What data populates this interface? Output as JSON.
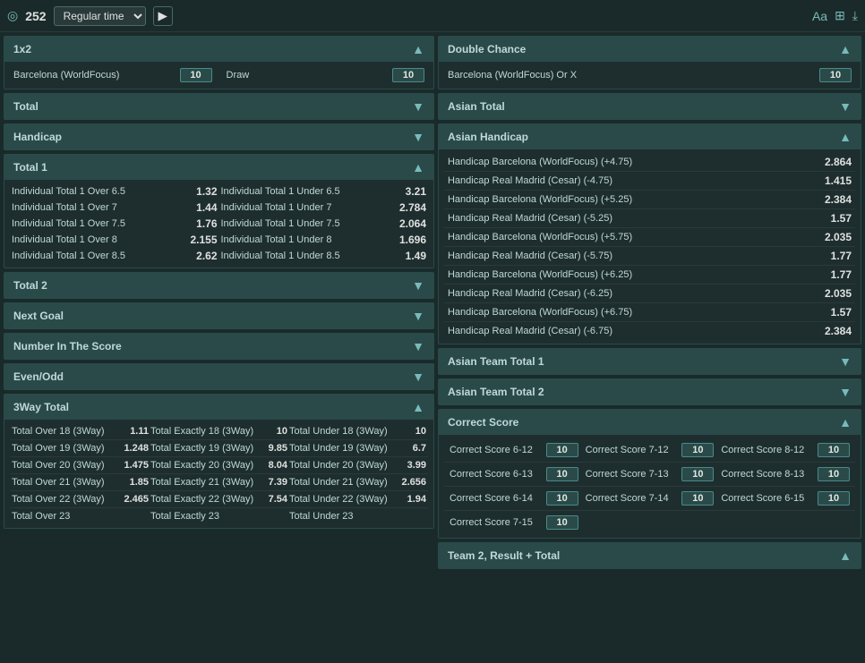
{
  "topbar": {
    "match_num": "252",
    "time_filter": "Regular time",
    "icons": {
      "eye": "◎",
      "text_size": "Aa",
      "grid": "⊞",
      "download": "⤓",
      "play": "▶"
    }
  },
  "left_col": {
    "sections": [
      {
        "id": "1x2",
        "title": "1x2",
        "collapsed": false,
        "arrow": "▲",
        "bets": [
          {
            "name": "Barcelona (WorldFocus)",
            "odds": "10"
          },
          {
            "name": "Draw",
            "odds": "10"
          }
        ]
      },
      {
        "id": "total",
        "title": "Total",
        "collapsed": true,
        "arrow": "▼"
      },
      {
        "id": "handicap",
        "title": "Handicap",
        "collapsed": true,
        "arrow": "▼"
      },
      {
        "id": "total1",
        "title": "Total 1",
        "collapsed": false,
        "arrow": "▲",
        "bet_pairs": [
          {
            "left": "Individual Total 1 Over 6.5",
            "left_odds": "1.32",
            "right": "Individual Total 1 Under 6.5",
            "right_odds": "3.21"
          },
          {
            "left": "Individual Total 1 Over 7",
            "left_odds": "1.44",
            "right": "Individual Total 1 Under 7",
            "right_odds": "2.784"
          },
          {
            "left": "Individual Total 1 Over 7.5",
            "left_odds": "1.76",
            "right": "Individual Total 1 Under 7.5",
            "right_odds": "2.064"
          },
          {
            "left": "Individual Total 1 Over 8",
            "left_odds": "2.155",
            "right": "Individual Total 1 Under 8",
            "right_odds": "1.696"
          },
          {
            "left": "Individual Total 1 Over 8.5",
            "left_odds": "2.62",
            "right": "Individual Total 1 Under 8.5",
            "right_odds": "1.49"
          }
        ]
      },
      {
        "id": "total2",
        "title": "Total 2",
        "collapsed": true,
        "arrow": "▼"
      },
      {
        "id": "next_goal",
        "title": "Next Goal",
        "collapsed": true,
        "arrow": "▼"
      },
      {
        "id": "number_in_score",
        "title": "Number In The Score",
        "collapsed": true,
        "arrow": "▼"
      },
      {
        "id": "even_odd",
        "title": "Even/Odd",
        "collapsed": true,
        "arrow": "▼"
      },
      {
        "id": "3way_total",
        "title": "3Way Total",
        "collapsed": false,
        "arrow": "▲",
        "bet_3way": [
          {
            "col1_name": "Total Over 18 (3Way)",
            "col1_odds": "1.11",
            "col2_name": "Total Exactly 18 (3Way)",
            "col2_odds": "10",
            "col3_name": "Total Under 18 (3Way)",
            "col3_odds": "10"
          },
          {
            "col1_name": "Total Over 19 (3Way)",
            "col1_odds": "1.248",
            "col2_name": "Total Exactly 19 (3Way)",
            "col2_odds": "9.85",
            "col3_name": "Total Under 19 (3Way)",
            "col3_odds": "6.7"
          },
          {
            "col1_name": "Total Over 20 (3Way)",
            "col1_odds": "1.475",
            "col2_name": "Total Exactly 20 (3Way)",
            "col2_odds": "8.04",
            "col3_name": "Total Under 20 (3Way)",
            "col3_odds": "3.99"
          },
          {
            "col1_name": "Total Over 21 (3Way)",
            "col1_odds": "1.85",
            "col2_name": "Total Exactly 21 (3Way)",
            "col2_odds": "7.39",
            "col3_name": "Total Under 21 (3Way)",
            "col3_odds": "2.656"
          },
          {
            "col1_name": "Total Over 22 (3Way)",
            "col1_odds": "2.465",
            "col2_name": "Total Exactly 22 (3Way)",
            "col2_odds": "7.54",
            "col3_name": "Total Under 22 (3Way)",
            "col3_odds": "1.94"
          },
          {
            "col1_name": "Total Over 23",
            "col1_odds": "",
            "col2_name": "Total Exactly 23",
            "col2_odds": "",
            "col3_name": "Total Under 23",
            "col3_odds": ""
          }
        ]
      }
    ]
  },
  "right_col": {
    "sections": [
      {
        "id": "double_chance",
        "title": "Double Chance",
        "collapsed": false,
        "arrow": "▲",
        "bets": [
          {
            "name": "Barcelona (WorldFocus) Or X",
            "odds": "10"
          }
        ]
      },
      {
        "id": "asian_total",
        "title": "Asian Total",
        "collapsed": true,
        "arrow": "▼"
      },
      {
        "id": "asian_handicap",
        "title": "Asian Handicap",
        "collapsed": false,
        "arrow": "▲",
        "bets_single": [
          {
            "name": "Handicap Barcelona (WorldFocus) (+4.75)",
            "odds": "2.864"
          },
          {
            "name": "Handicap Real Madrid (Cesar) (-4.75)",
            "odds": "1.415"
          },
          {
            "name": "Handicap Barcelona (WorldFocus) (+5.25)",
            "odds": "2.384"
          },
          {
            "name": "Handicap Real Madrid (Cesar) (-5.25)",
            "odds": "1.57"
          },
          {
            "name": "Handicap Barcelona (WorldFocus) (+5.75)",
            "odds": "2.035"
          },
          {
            "name": "Handicap Real Madrid (Cesar) (-5.75)",
            "odds": "1.77"
          },
          {
            "name": "Handicap Barcelona (WorldFocus) (+6.25)",
            "odds": "1.77"
          },
          {
            "name": "Handicap Real Madrid (Cesar) (-6.25)",
            "odds": "2.035"
          },
          {
            "name": "Handicap Barcelona (WorldFocus) (+6.75)",
            "odds": "1.57"
          },
          {
            "name": "Handicap Real Madrid (Cesar) (-6.75)",
            "odds": "2.384"
          }
        ]
      },
      {
        "id": "asian_team_total1",
        "title": "Asian Team Total 1",
        "collapsed": true,
        "arrow": "▼"
      },
      {
        "id": "asian_team_total2",
        "title": "Asian Team Total 2",
        "collapsed": true,
        "arrow": "▼"
      },
      {
        "id": "correct_score",
        "title": "Correct Score",
        "collapsed": false,
        "arrow": "▲",
        "rows": [
          [
            {
              "name": "Correct Score 6-12",
              "odds": "10"
            },
            {
              "name": "Correct Score 7-12",
              "odds": "10"
            },
            {
              "name": "Correct Score 8-12",
              "odds": "10"
            }
          ],
          [
            {
              "name": "Correct Score 6-13",
              "odds": "10"
            },
            {
              "name": "Correct Score 7-13",
              "odds": "10"
            },
            {
              "name": "Correct Score 8-13",
              "odds": "10"
            }
          ],
          [
            {
              "name": "Correct Score 6-14",
              "odds": "10"
            },
            {
              "name": "Correct Score 7-14",
              "odds": "10"
            },
            {
              "name": "Correct Score 6-15",
              "odds": "10"
            }
          ],
          [
            {
              "name": "Correct Score 7-15",
              "odds": "10"
            },
            null,
            null
          ]
        ]
      },
      {
        "id": "team2_result_total",
        "title": "Team 2, Result + Total",
        "collapsed": false,
        "arrow": "▲"
      }
    ]
  }
}
